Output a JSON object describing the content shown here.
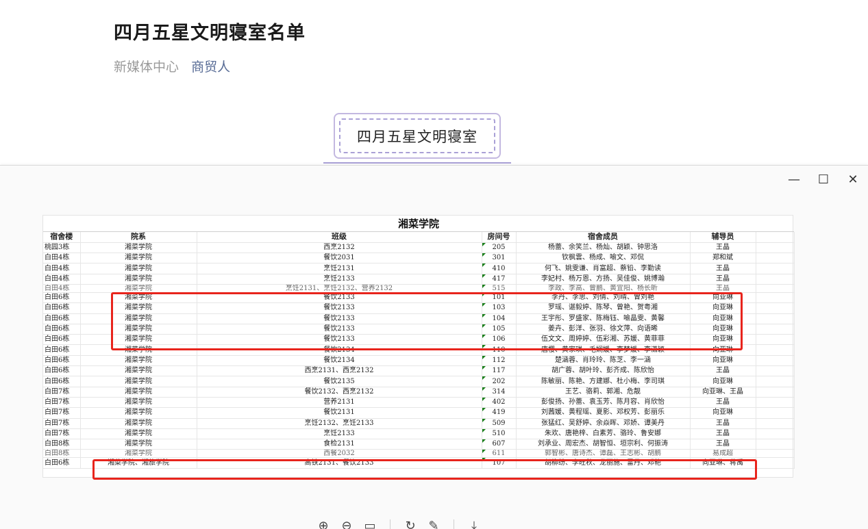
{
  "article": {
    "title": "四月五星文明寝室名单",
    "source": "新媒体中心",
    "author": "商贸人"
  },
  "tag": {
    "label": "四月五星文明寝室"
  },
  "viewer": {
    "window_controls": {
      "minimize": "—",
      "maximize": "☐",
      "close": "✕"
    },
    "toolbar_icons": [
      "zoom-in-icon",
      "zoom-out-icon",
      "fit-icon",
      "rotate-icon",
      "edit-icon",
      "download-icon"
    ]
  },
  "sheet": {
    "title": "湘菜学院",
    "headers": [
      "宿舍楼",
      "院系",
      "班级",
      "房间号",
      "宿舍成员",
      "辅导员"
    ],
    "rows": [
      [
        "桃园3栋",
        "湘菜学院",
        "西烹2132",
        "205",
        "杨蕾、余笑兰、杨灿、胡颖、钟思洛",
        "王晶"
      ],
      [
        "白田4栋",
        "湘菜学院",
        "餐饮2031",
        "301",
        "钦枫雲、杨成、喻文、邓侃",
        "郑和斌"
      ],
      [
        "白田4栋",
        "湘菜学院",
        "烹饪2131",
        "410",
        "何飞、姚雯谦、肖富超、蔡铅、李勤读",
        "王晶"
      ],
      [
        "白田4栋",
        "湘菜学院",
        "烹饪2133",
        "417",
        "李妃村、杨万恩、方扬、吴佳俊、姚博瀚",
        "王晶"
      ],
      [
        "白田4栋",
        "湘菜学院",
        "烹饪2131、烹饪2132、营养2132",
        "515",
        "李政、李高、曾鹏、黄宜阳、杨长昕",
        "王晶"
      ],
      [
        "白田6栋",
        "湘菜学院",
        "餐饮2133",
        "101",
        "李丹、李思、刘倩、刘晴、曾刘艳",
        "向亚琳"
      ],
      [
        "白田6栋",
        "湘菜学院",
        "餐饮2133",
        "103",
        "罗瑶、谌毅婷、陈琴、曾艳、贺粤湘",
        "向亚琳"
      ],
      [
        "白田6栋",
        "湘菜学院",
        "餐饮2133",
        "104",
        "王宇彤、罗盛家、陈梅钰、喻晶雯、黄馨",
        "向亚琳"
      ],
      [
        "白田6栋",
        "湘菜学院",
        "餐饮2133",
        "105",
        "姜卉、彭洋、张羽、徐文萍、向语晞",
        "向亚琳"
      ],
      [
        "白田6栋",
        "湘菜学院",
        "餐饮2133",
        "106",
        "伍文文、周婷婷、伍彩湘、苏媛、黄菲菲",
        "向亚琳"
      ],
      [
        "白田6栋",
        "湘菜学院",
        "餐饮2134",
        "110",
        "唐樱、黄家琪、毛娴媛、李梦媛、李潇颖",
        "向亚琳"
      ],
      [
        "白田6栋",
        "湘菜学院",
        "餐饮2134",
        "112",
        "楚涵蓉、肖玲玲、陈芝、李一涵",
        "向亚琳"
      ],
      [
        "白田6栋",
        "湘菜学院",
        "西烹2131、西烹2132",
        "117",
        "胡广蓉、胡叶玲、彭齐成、陈欣怡",
        "王晶"
      ],
      [
        "白田6栋",
        "湘菜学院",
        "餐饮2135",
        "202",
        "陈敏丽、陈艳、方建娜、杜小梅、李司琪",
        "向亚琳"
      ],
      [
        "白田7栋",
        "湘菜学院",
        "餐饮2132、西烹2132",
        "314",
        "王艺、骆莉、郭湘、危靓",
        "向亚琳、王晶"
      ],
      [
        "白田7栋",
        "湘菜学院",
        "营养2131",
        "402",
        "彭俊扬、孙蕾、袁玉芳、陈月容、肖欣怡",
        "王晶"
      ],
      [
        "白田7栋",
        "湘菜学院",
        "餐饮2131",
        "419",
        "刘茜媛、黄程瑶、夏影、邓权芳、彭丽乐",
        "向亚琳"
      ],
      [
        "白田7栋",
        "湘菜学院",
        "烹饪2132、烹饪2133",
        "509",
        "张猛红、吴舒婷、余焱晖、邓娇、谭美丹",
        "王晶"
      ],
      [
        "白田7栋",
        "湘菜学院",
        "烹饪2133",
        "510",
        "朱欢、唐艳梓、白素芳、骆玲、鲁安娜",
        "王晶"
      ],
      [
        "白田8栋",
        "湘菜学院",
        "食检2131",
        "607",
        "刘承业、周宏杰、胡智恒、垣宗利、何振涛",
        "王晶"
      ],
      [
        "白田8栋",
        "湘菜学院",
        "西餐2032",
        "611",
        "郭智彬、唐诗杰、谭磊、王志彬、胡鹏",
        "易成超"
      ],
      [
        "白田6栋",
        "湘菜学院、湘旅学院",
        "高铁2131、餐饮2133",
        "107",
        "胡柳纷、李旺秋、龙丽施、雷丹、邓艳",
        "向亚琳、蒋禹"
      ]
    ]
  }
}
